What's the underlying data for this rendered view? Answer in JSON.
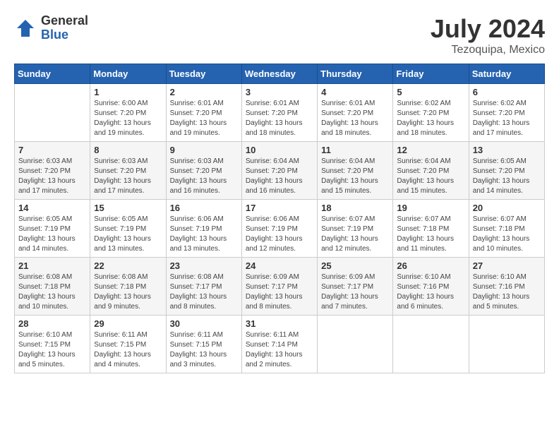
{
  "header": {
    "logo_general": "General",
    "logo_blue": "Blue",
    "title": "July 2024",
    "location": "Tezoquipa, Mexico"
  },
  "weekdays": [
    "Sunday",
    "Monday",
    "Tuesday",
    "Wednesday",
    "Thursday",
    "Friday",
    "Saturday"
  ],
  "weeks": [
    [
      {
        "day": "",
        "sunrise": "",
        "sunset": "",
        "daylight": ""
      },
      {
        "day": "1",
        "sunrise": "Sunrise: 6:00 AM",
        "sunset": "Sunset: 7:20 PM",
        "daylight": "Daylight: 13 hours and 19 minutes."
      },
      {
        "day": "2",
        "sunrise": "Sunrise: 6:01 AM",
        "sunset": "Sunset: 7:20 PM",
        "daylight": "Daylight: 13 hours and 19 minutes."
      },
      {
        "day": "3",
        "sunrise": "Sunrise: 6:01 AM",
        "sunset": "Sunset: 7:20 PM",
        "daylight": "Daylight: 13 hours and 18 minutes."
      },
      {
        "day": "4",
        "sunrise": "Sunrise: 6:01 AM",
        "sunset": "Sunset: 7:20 PM",
        "daylight": "Daylight: 13 hours and 18 minutes."
      },
      {
        "day": "5",
        "sunrise": "Sunrise: 6:02 AM",
        "sunset": "Sunset: 7:20 PM",
        "daylight": "Daylight: 13 hours and 18 minutes."
      },
      {
        "day": "6",
        "sunrise": "Sunrise: 6:02 AM",
        "sunset": "Sunset: 7:20 PM",
        "daylight": "Daylight: 13 hours and 17 minutes."
      }
    ],
    [
      {
        "day": "7",
        "sunrise": "Sunrise: 6:03 AM",
        "sunset": "Sunset: 7:20 PM",
        "daylight": "Daylight: 13 hours and 17 minutes."
      },
      {
        "day": "8",
        "sunrise": "Sunrise: 6:03 AM",
        "sunset": "Sunset: 7:20 PM",
        "daylight": "Daylight: 13 hours and 17 minutes."
      },
      {
        "day": "9",
        "sunrise": "Sunrise: 6:03 AM",
        "sunset": "Sunset: 7:20 PM",
        "daylight": "Daylight: 13 hours and 16 minutes."
      },
      {
        "day": "10",
        "sunrise": "Sunrise: 6:04 AM",
        "sunset": "Sunset: 7:20 PM",
        "daylight": "Daylight: 13 hours and 16 minutes."
      },
      {
        "day": "11",
        "sunrise": "Sunrise: 6:04 AM",
        "sunset": "Sunset: 7:20 PM",
        "daylight": "Daylight: 13 hours and 15 minutes."
      },
      {
        "day": "12",
        "sunrise": "Sunrise: 6:04 AM",
        "sunset": "Sunset: 7:20 PM",
        "daylight": "Daylight: 13 hours and 15 minutes."
      },
      {
        "day": "13",
        "sunrise": "Sunrise: 6:05 AM",
        "sunset": "Sunset: 7:20 PM",
        "daylight": "Daylight: 13 hours and 14 minutes."
      }
    ],
    [
      {
        "day": "14",
        "sunrise": "Sunrise: 6:05 AM",
        "sunset": "Sunset: 7:19 PM",
        "daylight": "Daylight: 13 hours and 14 minutes."
      },
      {
        "day": "15",
        "sunrise": "Sunrise: 6:05 AM",
        "sunset": "Sunset: 7:19 PM",
        "daylight": "Daylight: 13 hours and 13 minutes."
      },
      {
        "day": "16",
        "sunrise": "Sunrise: 6:06 AM",
        "sunset": "Sunset: 7:19 PM",
        "daylight": "Daylight: 13 hours and 13 minutes."
      },
      {
        "day": "17",
        "sunrise": "Sunrise: 6:06 AM",
        "sunset": "Sunset: 7:19 PM",
        "daylight": "Daylight: 13 hours and 12 minutes."
      },
      {
        "day": "18",
        "sunrise": "Sunrise: 6:07 AM",
        "sunset": "Sunset: 7:19 PM",
        "daylight": "Daylight: 13 hours and 12 minutes."
      },
      {
        "day": "19",
        "sunrise": "Sunrise: 6:07 AM",
        "sunset": "Sunset: 7:18 PM",
        "daylight": "Daylight: 13 hours and 11 minutes."
      },
      {
        "day": "20",
        "sunrise": "Sunrise: 6:07 AM",
        "sunset": "Sunset: 7:18 PM",
        "daylight": "Daylight: 13 hours and 10 minutes."
      }
    ],
    [
      {
        "day": "21",
        "sunrise": "Sunrise: 6:08 AM",
        "sunset": "Sunset: 7:18 PM",
        "daylight": "Daylight: 13 hours and 10 minutes."
      },
      {
        "day": "22",
        "sunrise": "Sunrise: 6:08 AM",
        "sunset": "Sunset: 7:18 PM",
        "daylight": "Daylight: 13 hours and 9 minutes."
      },
      {
        "day": "23",
        "sunrise": "Sunrise: 6:08 AM",
        "sunset": "Sunset: 7:17 PM",
        "daylight": "Daylight: 13 hours and 8 minutes."
      },
      {
        "day": "24",
        "sunrise": "Sunrise: 6:09 AM",
        "sunset": "Sunset: 7:17 PM",
        "daylight": "Daylight: 13 hours and 8 minutes."
      },
      {
        "day": "25",
        "sunrise": "Sunrise: 6:09 AM",
        "sunset": "Sunset: 7:17 PM",
        "daylight": "Daylight: 13 hours and 7 minutes."
      },
      {
        "day": "26",
        "sunrise": "Sunrise: 6:10 AM",
        "sunset": "Sunset: 7:16 PM",
        "daylight": "Daylight: 13 hours and 6 minutes."
      },
      {
        "day": "27",
        "sunrise": "Sunrise: 6:10 AM",
        "sunset": "Sunset: 7:16 PM",
        "daylight": "Daylight: 13 hours and 5 minutes."
      }
    ],
    [
      {
        "day": "28",
        "sunrise": "Sunrise: 6:10 AM",
        "sunset": "Sunset: 7:15 PM",
        "daylight": "Daylight: 13 hours and 5 minutes."
      },
      {
        "day": "29",
        "sunrise": "Sunrise: 6:11 AM",
        "sunset": "Sunset: 7:15 PM",
        "daylight": "Daylight: 13 hours and 4 minutes."
      },
      {
        "day": "30",
        "sunrise": "Sunrise: 6:11 AM",
        "sunset": "Sunset: 7:15 PM",
        "daylight": "Daylight: 13 hours and 3 minutes."
      },
      {
        "day": "31",
        "sunrise": "Sunrise: 6:11 AM",
        "sunset": "Sunset: 7:14 PM",
        "daylight": "Daylight: 13 hours and 2 minutes."
      },
      {
        "day": "",
        "sunrise": "",
        "sunset": "",
        "daylight": ""
      },
      {
        "day": "",
        "sunrise": "",
        "sunset": "",
        "daylight": ""
      },
      {
        "day": "",
        "sunrise": "",
        "sunset": "",
        "daylight": ""
      }
    ]
  ]
}
